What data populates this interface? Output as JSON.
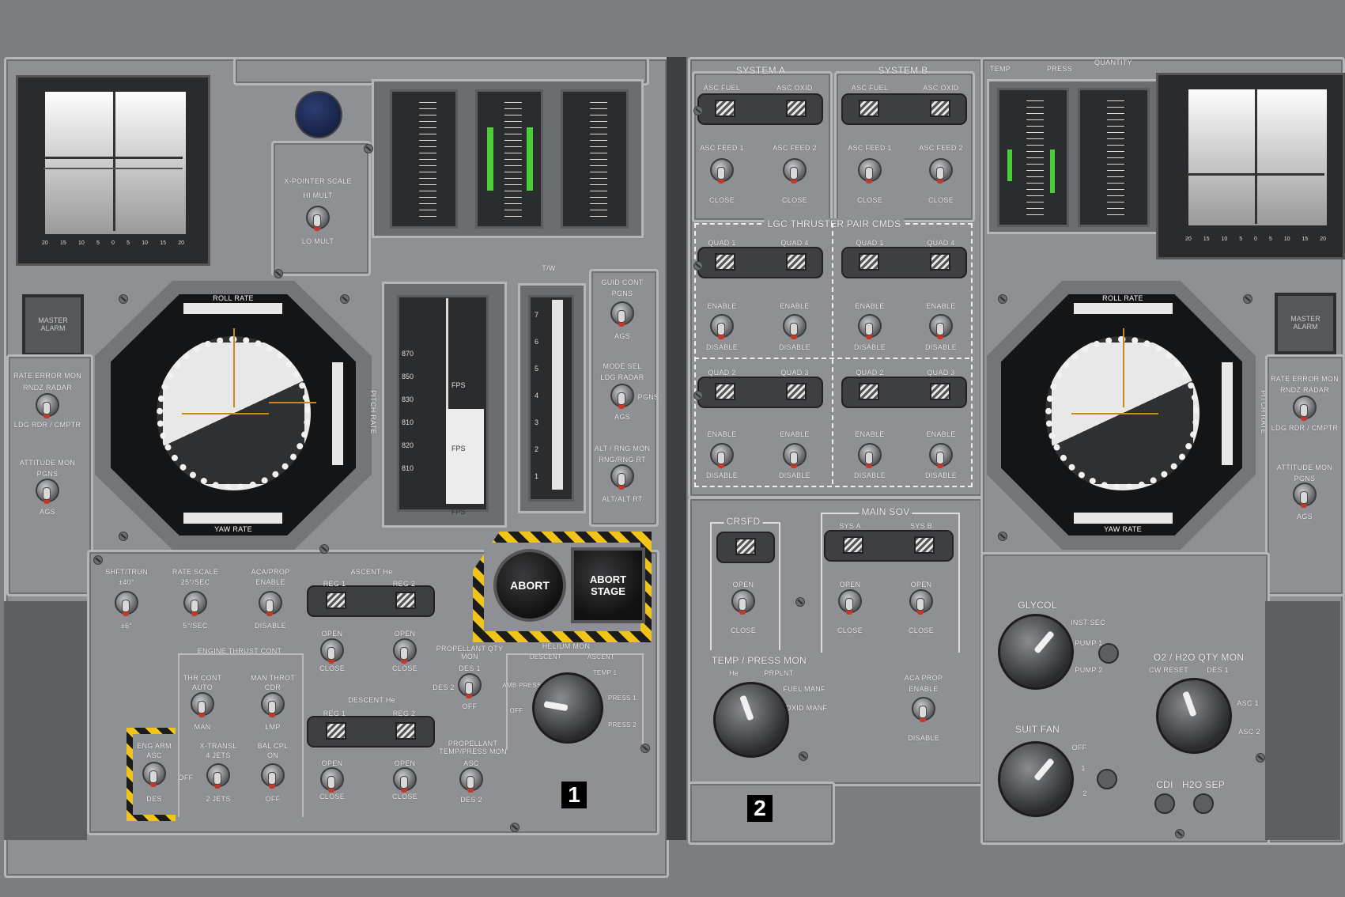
{
  "panels": {
    "panel1_number": "1",
    "panel2_number": "2"
  },
  "panel1": {
    "crossbar_left": {
      "ticks": [
        "20",
        "15",
        "10",
        "5",
        "0",
        "5",
        "10",
        "15",
        "20"
      ]
    },
    "master_alarm": "MASTER ALARM",
    "rate_error_mon": {
      "title": "RATE ERROR MON",
      "up": "RNDZ RADAR",
      "down": "LDG RDR / CMPTR"
    },
    "attitude_mon": {
      "title": "ATTITUDE MON",
      "up": "PGNS",
      "down": "AGS"
    },
    "x_pointer_scale": {
      "title": "X-POINTER SCALE",
      "up": "HI MULT",
      "down": "LO MULT"
    },
    "fdai": {
      "top": "ROLL RATE",
      "bottom": "YAW RATE",
      "side": "PITCH RATE"
    },
    "alt_tape": {
      "labels": [
        "FT",
        "FT",
        "FT",
        "FT"
      ],
      "values": [
        "870",
        "850",
        "830",
        "810",
        "820",
        "810"
      ],
      "fps": [
        "FPS",
        "FPS",
        "FPS"
      ]
    },
    "tw_label": "T/W",
    "tw_ticks": [
      "7",
      "6",
      "5",
      "4",
      "3",
      "2",
      "1"
    ],
    "guid_cont": {
      "title": "GUID CONT",
      "up": "PGNS",
      "down": "AGS"
    },
    "mode_sel": {
      "title": "MODE SEL",
      "up": "LDG RADAR",
      "right": "PGNS",
      "down": "AGS"
    },
    "alt_rng_mon": {
      "title": "ALT / RNG MON",
      "up": "RNG/RNG RT",
      "down": "ALT/ALT RT"
    },
    "lower": {
      "shift_tunnel": {
        "title": "SHFT/TRUN",
        "up": "±40°",
        "down": "±6°"
      },
      "rate_scale": {
        "title": "RATE SCALE",
        "up": "25°/SEC",
        "down": "5°/SEC"
      },
      "aca_prop": {
        "title": "ACA/PROP",
        "up": "ENABLE",
        "down": "DISABLE"
      },
      "ascent_he": {
        "title": "ASCENT He",
        "reg1": "REG 1",
        "reg2": "REG 2",
        "open": "OPEN",
        "close": "CLOSE"
      },
      "descent_he": {
        "title": "DESCENT He",
        "reg1": "REG 1",
        "reg2": "REG 2",
        "open": "OPEN",
        "close": "CLOSE"
      },
      "propellant_qty_mon": {
        "title": "PROPELLANT QTY MON",
        "up": "DES 1",
        "left": "DES 2",
        "down": "OFF"
      },
      "propellant_temp_mon": {
        "title": "PROPELLANT TEMP/PRESS MON",
        "up": "ASC",
        "down": "DES 2"
      },
      "helium_mon": {
        "title": "HELIUM MON",
        "items": [
          "DESCENT",
          "ASCENT",
          "AMB PRESS",
          "OFF",
          "TEMP 1",
          "PRESS 1",
          "PRESS 2"
        ]
      },
      "engine_thrust_cont": {
        "title": "ENGINE THRUST CONT",
        "thr_cont": "THR CONT",
        "auto": "AUTO",
        "man": "MAN",
        "man_throt": "MAN THROT",
        "cdr": "CDR",
        "lmp": "LMP"
      },
      "eng_arm": {
        "title": "ENG ARM",
        "up": "ASC",
        "right": "OFF",
        "down": "DES"
      },
      "x_transl": {
        "title": "X-TRANSL",
        "up": "4 JETS",
        "down": "2 JETS"
      },
      "bal_cpl": {
        "title": "BAL CPL",
        "up": "ON",
        "down": "OFF"
      },
      "abort": "ABORT",
      "abort_stage": "ABORT STAGE"
    }
  },
  "panel2": {
    "system_a": {
      "title": "SYSTEM A",
      "asc_fuel": "ASC FUEL",
      "asc_oxid": "ASC OXID",
      "feed1": "ASC FEED 1",
      "feed2": "ASC FEED 2",
      "close": "CLOSE"
    },
    "system_b": {
      "title": "SYSTEM B",
      "asc_fuel": "ASC FUEL",
      "asc_oxid": "ASC OXID",
      "feed1": "ASC FEED 1",
      "feed2": "ASC FEED 2",
      "close": "CLOSE"
    },
    "lgc_thruster": {
      "title": "LGC THRUSTER PAIR CMDS",
      "quads": [
        "QUAD 1",
        "QUAD 4",
        "QUAD 1",
        "QUAD 4",
        "QUAD 2",
        "QUAD 3",
        "QUAD 2",
        "QUAD 3"
      ],
      "enable": "ENABLE",
      "disable": "DISABLE"
    },
    "crsfd": {
      "title": "CRSFD",
      "open": "OPEN",
      "close": "CLOSE"
    },
    "main_sov": {
      "title": "MAIN SOV",
      "sys_a": "SYS A",
      "sys_b": "SYS B",
      "open": "OPEN",
      "close": "CLOSE"
    },
    "temp_press_mon": {
      "title": "TEMP / PRESS MON",
      "items": [
        "He",
        "PRPLNT",
        "FUEL MANF",
        "OXID MANF"
      ]
    },
    "aca_prop": {
      "title": "ACA PROP",
      "up": "ENABLE",
      "down": "DISABLE"
    },
    "top_labels": {
      "temp": "TEMP",
      "press": "PRESS",
      "quantity": "QUANTITY"
    }
  },
  "panel3": {
    "crossbar_right": {
      "ticks": [
        "20",
        "15",
        "10",
        "5",
        "0",
        "5",
        "10",
        "15",
        "20"
      ]
    },
    "master_alarm": "MASTER ALARM",
    "rate_error_mon": {
      "title": "RATE ERROR MON",
      "up": "RNDZ RADAR",
      "down": "LDG RDR / CMPTR"
    },
    "attitude_mon": {
      "title": "ATTITUDE MON",
      "up": "PGNS",
      "down": "AGS"
    },
    "fdai": {
      "top": "ROLL RATE",
      "bottom": "YAW RATE",
      "side": "PITCH RATE"
    },
    "glycol": {
      "title": "GLYCOL",
      "items": [
        "INST SEC",
        "PUMP 1",
        "PUMP 2"
      ]
    },
    "suit_fan": {
      "title": "SUIT FAN",
      "items": [
        "OFF",
        "1",
        "2"
      ]
    },
    "o2_h2o_qty_mon": {
      "title": "O2 / H2O QTY MON",
      "items": [
        "CW RESET",
        "DES 1",
        "ASC 1",
        "ASC 2"
      ]
    },
    "cdi": "CDI",
    "h2o_sep": "H2O SEP"
  },
  "colors": {
    "panel": "#8e9093",
    "frame": "#b4b6b8",
    "hazard_yellow": "#f0c419",
    "indicator_green": "#4ccd3a",
    "fdai_orange": "#c98a1a"
  }
}
